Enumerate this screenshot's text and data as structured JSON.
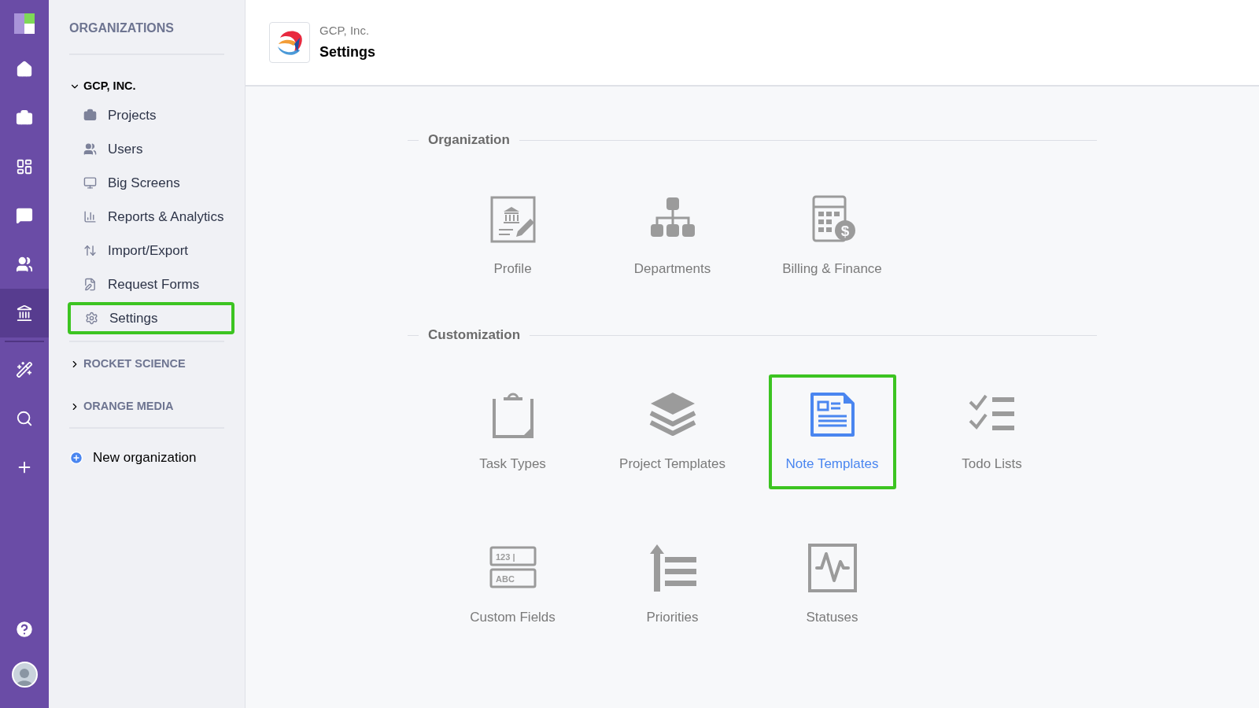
{
  "rail": {
    "items": [
      {
        "kind": "home",
        "selected": false
      },
      {
        "kind": "briefcase",
        "selected": false
      },
      {
        "kind": "board",
        "selected": false
      },
      {
        "kind": "chat",
        "selected": false
      },
      {
        "kind": "users",
        "selected": false
      },
      {
        "kind": "bank",
        "selected": true
      },
      {
        "kind": "wand",
        "selected": false
      },
      {
        "kind": "search",
        "selected": false
      },
      {
        "kind": "plus",
        "selected": false
      }
    ],
    "bottom": [
      {
        "kind": "help"
      },
      {
        "kind": "avatar"
      }
    ]
  },
  "sidebar": {
    "title": "ORGANIZATIONS",
    "organizations": [
      {
        "name": "GCP, INC.",
        "expanded": true,
        "items": [
          {
            "label": "Projects",
            "kind": "briefcase",
            "selected": false
          },
          {
            "label": "Users",
            "kind": "users",
            "selected": false
          },
          {
            "label": "Big Screens",
            "kind": "screen",
            "selected": false
          },
          {
            "label": "Reports & Analytics",
            "kind": "chart",
            "selected": false
          },
          {
            "label": "Import/Export",
            "kind": "arrows",
            "selected": false
          },
          {
            "label": "Request Forms",
            "kind": "form",
            "selected": false
          },
          {
            "label": "Settings",
            "kind": "gear",
            "selected": true
          }
        ]
      },
      {
        "name": "ROCKET SCIENCE",
        "expanded": false
      },
      {
        "name": "ORANGE MEDIA",
        "expanded": false
      }
    ],
    "new_organization": "New organization"
  },
  "header": {
    "organization": "GCP, Inc.",
    "title": "Settings"
  },
  "sections": [
    {
      "title": "Organization",
      "tiles": [
        {
          "label": "Profile",
          "kind": "profile",
          "selected": false
        },
        {
          "label": "Departments",
          "kind": "departments",
          "selected": false
        },
        {
          "label": "Billing & Finance",
          "kind": "billing",
          "selected": false,
          "icon_texts": [
            "$"
          ]
        }
      ]
    },
    {
      "title": "Customization",
      "tiles": [
        {
          "label": "Task Types",
          "kind": "clipboard",
          "selected": false
        },
        {
          "label": "Project Templates",
          "kind": "layers",
          "selected": false
        },
        {
          "label": "Note Templates",
          "kind": "note",
          "selected": true
        },
        {
          "label": "Todo Lists",
          "kind": "todo",
          "selected": false
        },
        {
          "label": "Custom Fields",
          "kind": "fields",
          "selected": false,
          "icon_texts": [
            "123 |",
            "ABC"
          ]
        },
        {
          "label": "Priorities",
          "kind": "priorities",
          "selected": false
        },
        {
          "label": "Statuses",
          "kind": "statuses",
          "selected": false
        }
      ]
    }
  ]
}
